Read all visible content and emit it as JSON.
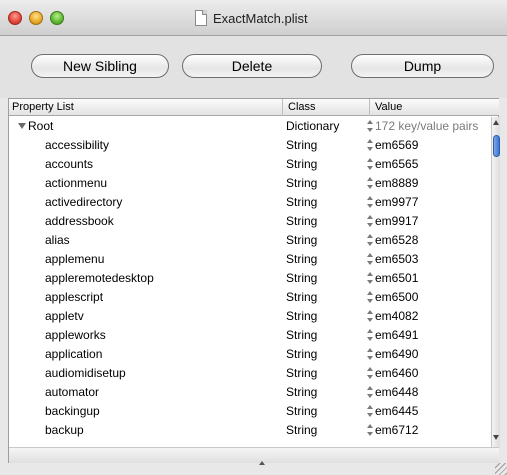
{
  "window": {
    "title": "ExactMatch.plist"
  },
  "toolbar": {
    "new_sibling_label": "New Sibling",
    "delete_label": "Delete",
    "dump_label": "Dump"
  },
  "table": {
    "headers": {
      "property_list": "Property List",
      "class": "Class",
      "value": "Value"
    },
    "root": {
      "key": "Root",
      "class": "Dictionary",
      "value": "172 key/value pairs"
    },
    "rows": [
      {
        "key": "accessibility",
        "class": "String",
        "value": "em6569"
      },
      {
        "key": "accounts",
        "class": "String",
        "value": "em6565"
      },
      {
        "key": "actionmenu",
        "class": "String",
        "value": "em8889"
      },
      {
        "key": "activedirectory",
        "class": "String",
        "value": "em9977"
      },
      {
        "key": "addressbook",
        "class": "String",
        "value": "em9917"
      },
      {
        "key": "alias",
        "class": "String",
        "value": "em6528"
      },
      {
        "key": "applemenu",
        "class": "String",
        "value": "em6503"
      },
      {
        "key": "appleremotedesktop",
        "class": "String",
        "value": "em6501"
      },
      {
        "key": "applescript",
        "class": "String",
        "value": "em6500"
      },
      {
        "key": "appletv",
        "class": "String",
        "value": "em4082"
      },
      {
        "key": "appleworks",
        "class": "String",
        "value": "em6491"
      },
      {
        "key": "application",
        "class": "String",
        "value": "em6490"
      },
      {
        "key": "audiomidisetup",
        "class": "String",
        "value": "em6460"
      },
      {
        "key": "automator",
        "class": "String",
        "value": "em6448"
      },
      {
        "key": "backingup",
        "class": "String",
        "value": "em6445"
      },
      {
        "key": "backup",
        "class": "String",
        "value": "em6712"
      }
    ]
  },
  "icons": {
    "close": "close-button",
    "minimize": "minimize-button",
    "zoom": "zoom-button",
    "document": "document-icon",
    "disclosure": "disclosure-triangle-icon",
    "stepper": "stepper-icon"
  }
}
